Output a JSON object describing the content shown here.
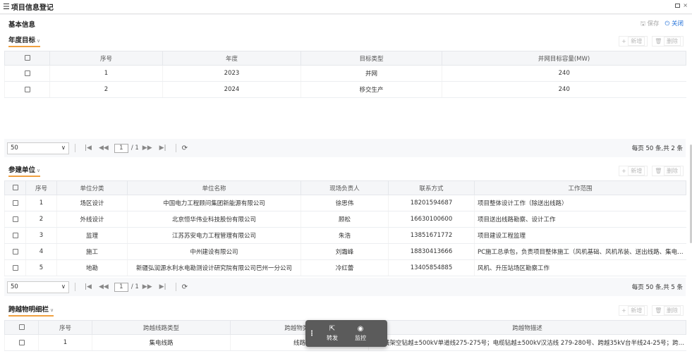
{
  "window": {
    "title": "项目信息登记"
  },
  "basic": {
    "title": "基本信息",
    "save": "保存",
    "close": "关闭"
  },
  "annual": {
    "title": "年度目标",
    "add": "新增",
    "delete": "删除",
    "headers": [
      "序号",
      "年度",
      "目标类型",
      "并网目标容量(MW)"
    ],
    "rows": [
      {
        "no": "1",
        "year": "2023",
        "type": "并网",
        "cap": "240"
      },
      {
        "no": "2",
        "year": "2024",
        "type": "移交生产",
        "cap": "240"
      }
    ],
    "pager": {
      "size": "50",
      "page": "1",
      "total_pages": "/ 1",
      "summary": "每页 50 条,共 2 条"
    }
  },
  "units": {
    "title": "参建单位",
    "add": "新增",
    "delete": "删除",
    "headers": [
      "序号",
      "单位分类",
      "单位名称",
      "现场负责人",
      "联系方式",
      "工作范围"
    ],
    "rows": [
      {
        "no": "1",
        "cat": "场区设计",
        "name": "中国电力工程顾问集团新能源有限公司",
        "person": "徐思伟",
        "phone": "18201594687",
        "scope": "项目整体设计工作（除送出线路）"
      },
      {
        "no": "2",
        "cat": "外线设计",
        "name": "北京恒华伟业科技股份有限公司",
        "person": "顾松",
        "phone": "16630100600",
        "scope": "项目送出线路勘察、设计工作"
      },
      {
        "no": "3",
        "cat": "监理",
        "name": "江苏苏安电力工程管理有限公司",
        "person": "朱浩",
        "phone": "13851671772",
        "scope": "项目建设工程监理"
      },
      {
        "no": "4",
        "cat": "施工",
        "name": "中州建设有限公司",
        "person": "刘霜峰",
        "phone": "18830413666",
        "scope": "PC施工总承包，负责项目整体施工（风机基础、风机吊装、送出线路、集电线..."
      },
      {
        "no": "5",
        "cat": "地勘",
        "name": "新疆弘润源水利水电勘测设计研究院有限公司巴州一分公司",
        "person": "冷红蕾",
        "phone": "13405854885",
        "scope": "风机、升压站场区勘察工作"
      }
    ],
    "pager": {
      "size": "50",
      "page": "1",
      "total_pages": "/ 1",
      "summary": "每页 50 条,共 5 条"
    }
  },
  "cross": {
    "title": "跨越物明细栏",
    "add": "新增",
    "delete": "删除",
    "headers": [
      "序号",
      "跨越线路类型",
      "跨越物类型",
      "跨越物描述"
    ],
    "rows": [
      {
        "no": "1",
        "line_type": "集电线路",
        "obj_type": "线路",
        "desc": "集电线架空钻越±500kV单道线275-275号；电缆钻越±500kV汉沽线 279-280号、跨越35kV台半线24-25号；跨越..."
      }
    ]
  },
  "floatbar": {
    "forward": "转发",
    "monitor": "监控"
  }
}
